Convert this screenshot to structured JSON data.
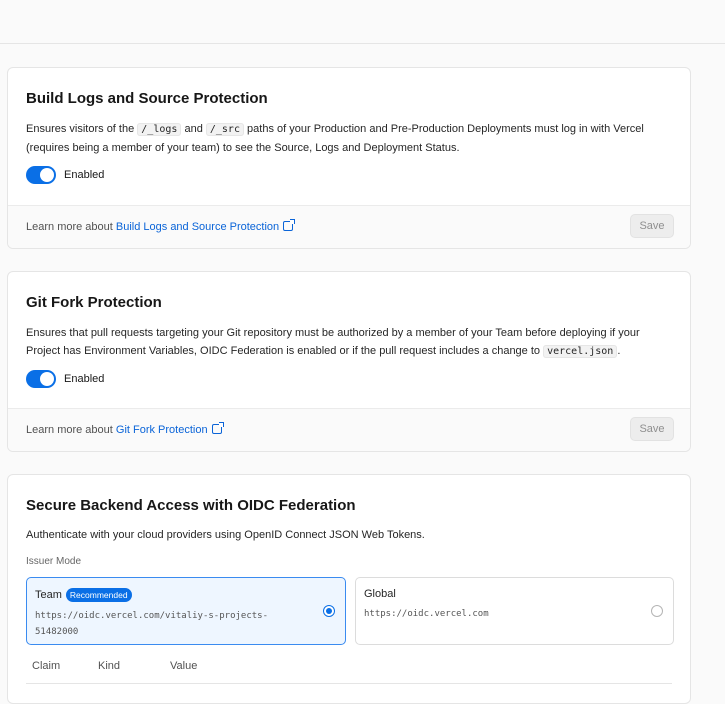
{
  "build_logs": {
    "title": "Build Logs and Source Protection",
    "desc_1": "Ensures visitors of the ",
    "code_logs": "/_logs",
    "desc_2": " and ",
    "code_src": "/_src",
    "desc_3": " paths of your Production and Pre-Production Deployments must log in with Vercel (requires being a member of your team) to see the Source, Logs and Deployment Status.",
    "toggle_label": "Enabled",
    "toggle_on": true,
    "learn_prefix": "Learn more about ",
    "learn_link": "Build Logs and Source Protection",
    "save_label": "Save"
  },
  "git_fork": {
    "title": "Git Fork Protection",
    "desc_1": "Ensures that pull requests targeting your Git repository must be authorized by a member of your Team before deploying if your Project has Environment Variables, OIDC Federation is enabled or if the pull request includes a change to ",
    "code_file": "vercel.json",
    "desc_2": ".",
    "toggle_label": "Enabled",
    "toggle_on": true,
    "learn_prefix": "Learn more about ",
    "learn_link": "Git Fork Protection",
    "save_label": "Save"
  },
  "oidc": {
    "title": "Secure Backend Access with OIDC Federation",
    "desc": "Authenticate with your cloud providers using OpenID Connect JSON Web Tokens.",
    "issuer_label": "Issuer Mode",
    "options": [
      {
        "title": "Team",
        "badge": "Recommended",
        "url": "https://oidc.vercel.com/vitaliy-s-projects-51482000",
        "selected": true
      },
      {
        "title": "Global",
        "url": "https://oidc.vercel.com",
        "selected": false
      }
    ],
    "table_headers": [
      "Claim",
      "Kind",
      "Value"
    ]
  },
  "colors": {
    "accent": "#0a6fe6",
    "link": "#0a64d8"
  },
  "icons": {
    "external_link": "external-link-icon"
  }
}
